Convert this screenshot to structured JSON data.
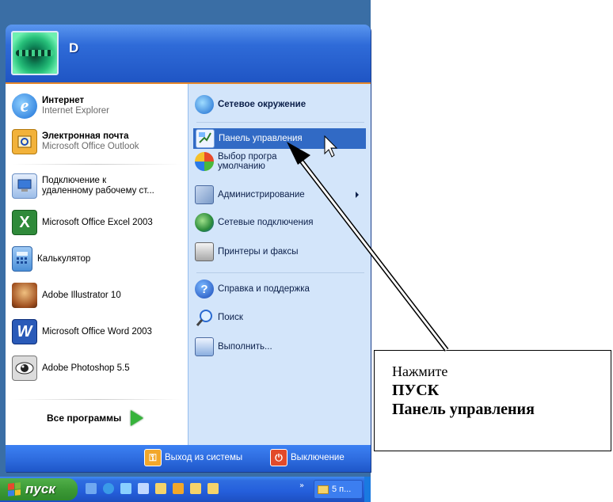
{
  "user": {
    "name": "D"
  },
  "left_pinned": [
    {
      "title": "Интернет",
      "subtitle": "Internet Explorer",
      "icon": "internet-explorer-icon"
    },
    {
      "title": "Электронная почта",
      "subtitle": "Microsoft Office Outlook",
      "icon": "outlook-icon"
    }
  ],
  "left_recent": [
    {
      "line1": "Подключение к",
      "line2": "удаленному рабочему ст...",
      "icon": "remote-desktop-icon"
    },
    {
      "line1": "Microsoft Office Excel 2003",
      "icon": "excel-icon"
    },
    {
      "line1": "Калькулятор",
      "icon": "calculator-icon"
    },
    {
      "line1": "Adobe Illustrator 10",
      "icon": "illustrator-icon"
    },
    {
      "line1": "Microsoft Office Word 2003",
      "icon": "word-icon"
    },
    {
      "line1": "Adobe Photoshop 5.5",
      "icon": "photoshop-icon"
    }
  ],
  "all_programs": "Все программы",
  "right_items": [
    {
      "label": "Сетевое окружение",
      "icon": "network-places-icon"
    },
    {
      "label": "Панель управления",
      "icon": "control-panel-icon"
    },
    {
      "line1": "Выбор програ",
      "line2": "умолчанию",
      "icon": "default-programs-icon"
    },
    {
      "label": "Администрирование",
      "icon": "admin-tools-icon"
    },
    {
      "label": "Сетевые подключения",
      "icon": "network-connections-icon"
    },
    {
      "label": "Принтеры и факсы",
      "icon": "printer-icon"
    },
    {
      "label": "Справка и поддержка",
      "icon": "help-icon"
    },
    {
      "label": "Поиск",
      "icon": "search-icon"
    },
    {
      "label": "Выполнить...",
      "icon": "run-icon"
    }
  ],
  "footer": {
    "logoff": "Выход из системы",
    "shutdown": "Выключение"
  },
  "taskbar": {
    "start": "пуск",
    "task": "5 п...",
    "chevron": "»"
  },
  "callout": {
    "line1": "Нажмите",
    "line2": "ПУСК",
    "line3": "Панель управления"
  },
  "colors": {
    "highlight": "#316ac5",
    "taskbar": "#245edb",
    "start_green": "#3c9a36",
    "menu_right": "#d3e5fa"
  }
}
